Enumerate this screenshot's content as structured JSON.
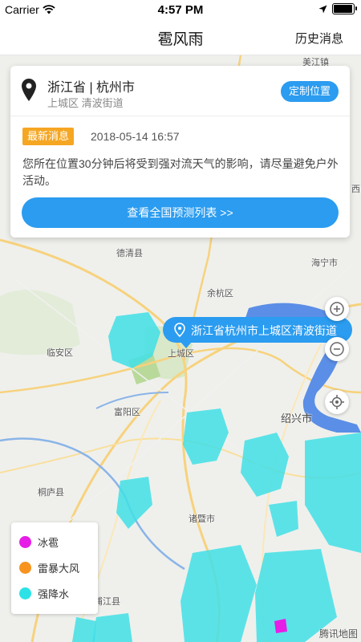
{
  "status_bar": {
    "carrier": "Carrier",
    "time": "4:57 PM",
    "battery_level": 0.9
  },
  "nav": {
    "title": "雹风雨",
    "history_label": "历史消息"
  },
  "card": {
    "province_city": "浙江省 | 杭州市",
    "district_street": "上城区 清波街道",
    "custom_location_label": "定制位置",
    "badge_label": "最新消息",
    "datetime": "2018-05-14 16:57",
    "message": "您所在位置30分钟后将受到强对流天气的影响，请尽量避免户外活动。",
    "forecast_button_label": "查看全国预测列表 >>"
  },
  "map": {
    "location_bubble": "浙江省杭州市上城区清波街道",
    "places": {
      "meiyang": "美江镇",
      "deqing": "德清县",
      "haining": "海宁市",
      "yuhang": "余杭区",
      "lin_an": "临安区",
      "shangcheng": "上城区",
      "fuyang": "富阳区",
      "shaoxing": "绍兴市",
      "tonglu": "桐庐县",
      "zhuji": "诸暨市",
      "pujiang": "浦江县",
      "xi": "西"
    },
    "watermark": "腾讯地图"
  },
  "legend": {
    "items": [
      {
        "label": "冰雹",
        "color": "#e61ee6"
      },
      {
        "label": "雷暴大风",
        "color": "#f7931e"
      },
      {
        "label": "强降水",
        "color": "#2de2e6"
      }
    ]
  },
  "icons": {
    "wifi": "wifi-icon",
    "location_arrow": "location-arrow-icon",
    "battery": "battery-icon",
    "pin": "map-pin-icon",
    "zoom_in": "zoom-in-icon",
    "zoom_out": "zoom-out-icon",
    "locate": "locate-icon"
  },
  "colors": {
    "accent": "#2b9cf0",
    "badge": "#f5a623"
  }
}
